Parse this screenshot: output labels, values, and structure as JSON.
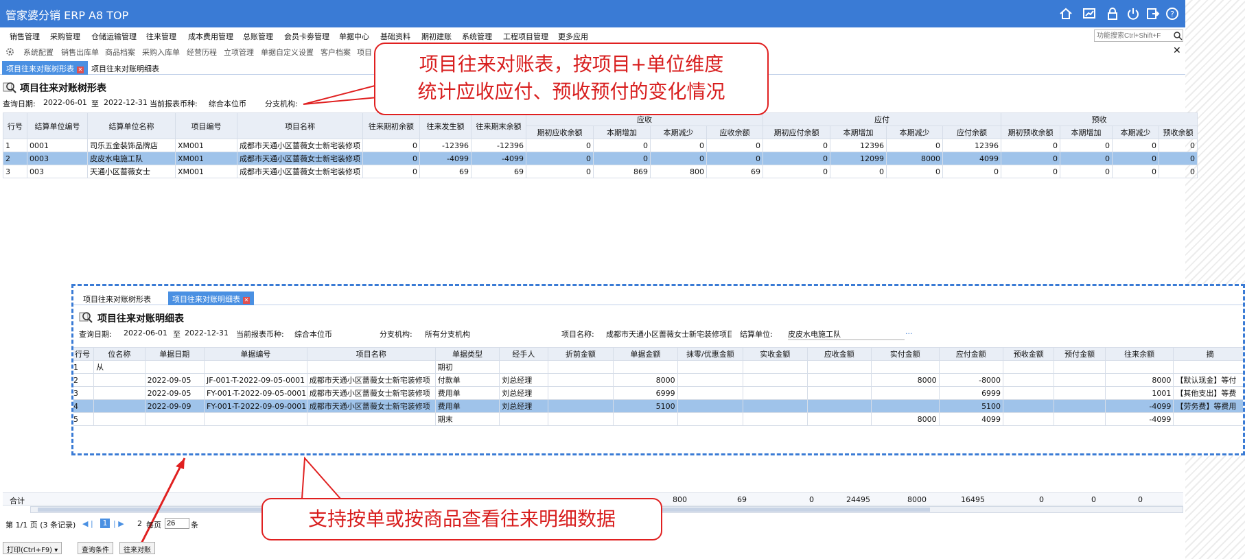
{
  "app": {
    "title": "管家婆分销 ERP A8 TOP"
  },
  "toolbar_icons": [
    "home-icon",
    "chart-icon",
    "lock-icon",
    "power-icon",
    "logout-icon",
    "help-icon"
  ],
  "menu": [
    "销售管理",
    "采购管理",
    "仓储运输管理",
    "往来管理",
    "成本费用管理",
    "总账管理",
    "会员卡劵管理",
    "单据中心",
    "基础资料",
    "期初建账",
    "系统管理",
    "工程项目管理",
    "更多应用"
  ],
  "search": {
    "placeholder": "功能搜索Ctrl+Shift+F"
  },
  "subnav": [
    "系统配置",
    "销售出库单",
    "商品档案",
    "采购入库单",
    "经营历程",
    "立项管理",
    "单据自定义设置",
    "客户档案",
    "项目"
  ],
  "tabs": [
    {
      "label": "项目往来对账树形表",
      "active": true
    },
    {
      "label": "项目往来对账明细表",
      "active": false
    }
  ],
  "report": {
    "title": "项目往来对账树形表",
    "query_date_label": "查询日期:",
    "date_from": "2022-06-01",
    "to_label": "至",
    "date_to": "2022-12-31",
    "currency_label": "当前报表币种:",
    "currency": "综合本位币",
    "branch_label": "分支机构:"
  },
  "main_table": {
    "headers": [
      "行号",
      "结算单位编号",
      "结算单位名称",
      "项目编号",
      "项目名称",
      "往来期初余额",
      "往来发生额",
      "往来期末余额",
      "期初应收余额",
      "本期增加",
      "本期减少",
      "应收余额",
      "期初应付余额",
      "本期增加",
      "本期减少",
      "应付余额",
      "期初预收余额",
      "本期增加",
      "本期减少",
      "预收余额"
    ],
    "group_headers": [
      "应收",
      "应付",
      "预收"
    ],
    "rows": [
      [
        "1",
        "0001",
        "司乐五金装饰品牌店",
        "XM001",
        "成都市天通小区蔷薇女士新宅装修项",
        "0",
        "-12396",
        "-12396",
        "0",
        "0",
        "0",
        "0",
        "0",
        "12396",
        "0",
        "12396",
        "0",
        "0",
        "0",
        "0"
      ],
      [
        "2",
        "0003",
        "皮皮水电施工队",
        "XM001",
        "成都市天通小区蔷薇女士新宅装修项",
        "0",
        "-4099",
        "-4099",
        "0",
        "0",
        "0",
        "0",
        "0",
        "12099",
        "8000",
        "4099",
        "0",
        "0",
        "0",
        "0"
      ],
      [
        "3",
        "003",
        "天通小区蔷薇女士",
        "XM001",
        "成都市天通小区蔷薇女士新宅装修项",
        "0",
        "69",
        "69",
        "0",
        "869",
        "800",
        "69",
        "0",
        "0",
        "0",
        "0",
        "0",
        "0",
        "0",
        "0"
      ]
    ],
    "total_label": "合计",
    "totals": [
      "800",
      "69",
      "0",
      "24495",
      "8000",
      "16495",
      "0",
      "0",
      "0"
    ]
  },
  "annotation1": {
    "line1": "项目往来对账表，按项目+单位维度",
    "line2": "统计应收应付、预收预付的变化情况"
  },
  "annotation2": {
    "text": "支持按单或按商品查看往来明细数据"
  },
  "detail": {
    "tabs": [
      {
        "label": "项目往来对账树形表"
      },
      {
        "label": "项目往来对账明细表"
      }
    ],
    "title": "项目往来对账明细表",
    "query_date_label": "查询日期:",
    "date_from": "2022-06-01",
    "to_label": "至",
    "date_to": "2022-12-31",
    "currency_label": "当前报表币种:",
    "currency": "综合本位币",
    "branch_label": "分支机构:",
    "branch": "所有分支机构",
    "project_label": "项目名称:",
    "project": "成都市天通小区蔷薇女士新宅装修项目",
    "unit_label": "结算单位:",
    "unit": "皮皮水电施工队",
    "more": "...",
    "headers": [
      "行号",
      "位名称",
      "单据日期",
      "单据编号",
      "项目名称",
      "单据类型",
      "经手人",
      "折前金额",
      "单据金额",
      "抹零/优惠金额",
      "实收金额",
      "应收金额",
      "实付金额",
      "应付金额",
      "预收金额",
      "预付金额",
      "往来余额",
      "摘"
    ],
    "rows": [
      [
        "1",
        "从",
        "",
        "",
        "",
        "期初",
        "",
        "",
        "",
        "",
        "",
        "",
        "",
        "",
        "",
        "",
        "",
        ""
      ],
      [
        "2",
        "",
        "2022-09-05",
        "JF-001-T-2022-09-05-0001",
        "成都市天通小区蔷薇女士新宅装修项",
        "付款单",
        "刘总经理",
        "",
        "8000",
        "",
        "",
        "",
        "8000",
        "-8000",
        "",
        "",
        "8000",
        "【默认现金】等付"
      ],
      [
        "3",
        "",
        "2022-09-05",
        "FY-001-T-2022-09-05-0001",
        "成都市天通小区蔷薇女士新宅装修项",
        "费用单",
        "刘总经理",
        "",
        "6999",
        "",
        "",
        "",
        "",
        "6999",
        "",
        "",
        "1001",
        "【其他支出】等费"
      ],
      [
        "4",
        "",
        "2022-09-09",
        "FY-001-T-2022-09-09-0001",
        "成都市天通小区蔷薇女士新宅装修项",
        "费用单",
        "刘总经理",
        "",
        "5100",
        "",
        "",
        "",
        "",
        "5100",
        "",
        "",
        "-4099",
        "【劳务费】等费用"
      ],
      [
        "5",
        "",
        "",
        "",
        "",
        "期末",
        "",
        "",
        "",
        "",
        "",
        "",
        "8000",
        "4099",
        "",
        "",
        "-4099",
        ""
      ]
    ]
  },
  "pagination": {
    "page_text": "第 1/1 页 (3 条记录)",
    "current": "1",
    "next_page": "2",
    "per_page_label": "每页",
    "per_page": "26",
    "unit": "条"
  },
  "buttons": {
    "print": "打印(Ctrl+F9)",
    "query": "查询条件",
    "reconcile": "往来对账"
  },
  "colors": {
    "brand": "#3a7bd5",
    "selected_row": "#9fc3ea",
    "annotation": "#d81e1e"
  }
}
